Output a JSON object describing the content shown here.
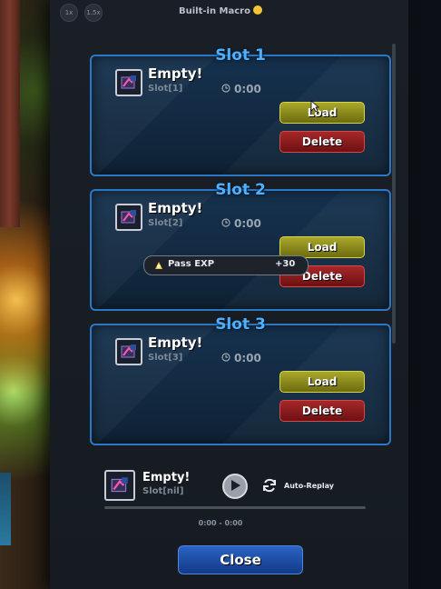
{
  "header": {
    "speed_1": "1x",
    "speed_2": "1.5x",
    "title": "Built-in Macro"
  },
  "slots": [
    {
      "title": "Slot 1",
      "name": "Empty!",
      "sub": "Slot[1]",
      "time": "0:00",
      "load": "Load",
      "delete": "Delete"
    },
    {
      "title": "Slot 2",
      "name": "Empty!",
      "sub": "Slot[2]",
      "time": "0:00",
      "load": "Load",
      "delete": "Delete"
    },
    {
      "title": "Slot 3",
      "name": "Empty!",
      "sub": "Slot[3]",
      "time": "0:00",
      "load": "Load",
      "delete": "Delete"
    }
  ],
  "toast": {
    "label": "Pass EXP",
    "value": "+30"
  },
  "current": {
    "name": "Empty!",
    "sub": "Slot[nil]",
    "auto_replay": "Auto-Replay",
    "time_range": "0:00 - 0:00"
  },
  "close_label": "Close",
  "icons": {
    "slot": "macro-icon",
    "clock": "clock-icon",
    "play": "play-icon",
    "replay": "replay-icon",
    "exp": "exp-icon"
  },
  "colors": {
    "slot_title": "#4fb0ff",
    "load": "#a9a82a",
    "delete": "#a5282a",
    "close": "#2a63c4"
  }
}
